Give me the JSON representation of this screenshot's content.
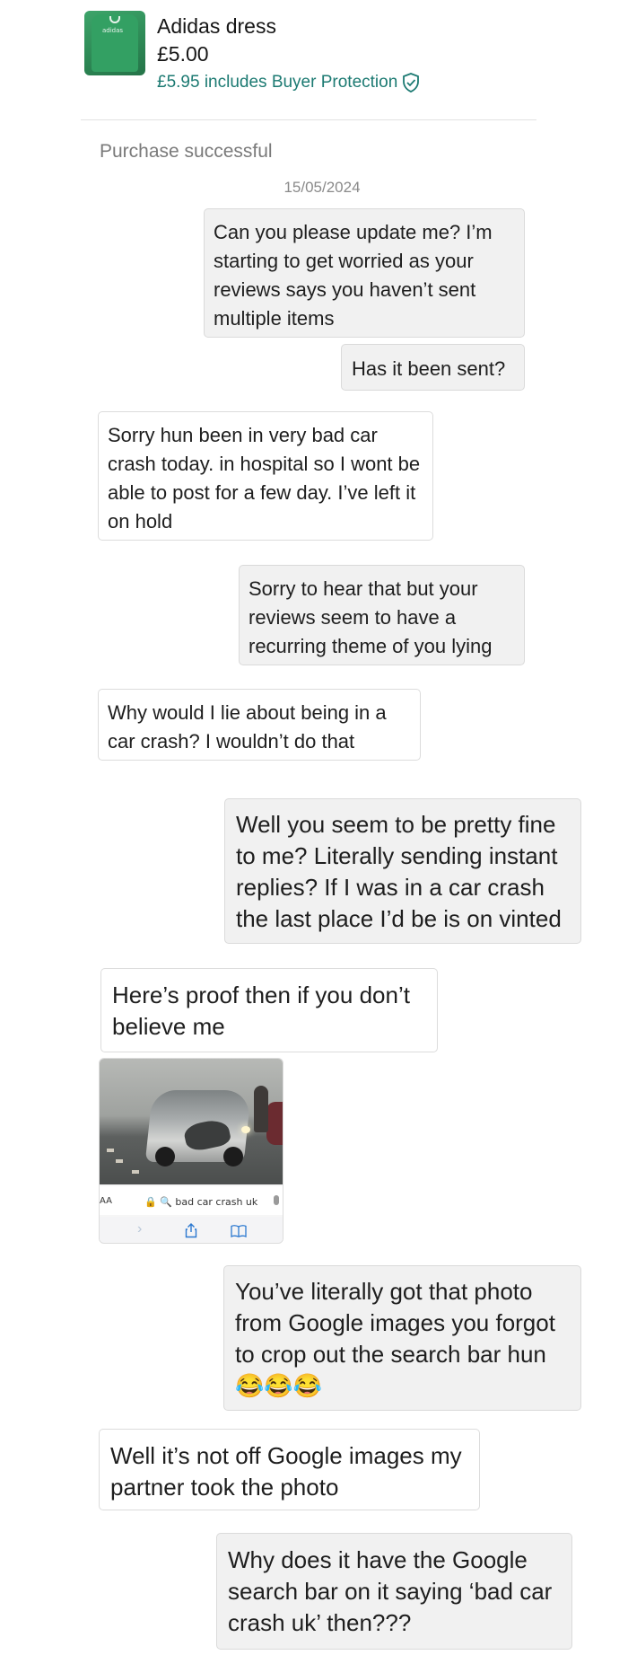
{
  "item": {
    "title": "Adidas dress",
    "price": "£5.00",
    "protection": "£5.95 includes Buyer Protection",
    "thumb_brand": "adidas"
  },
  "status": "Purchase successful",
  "date": "15/05/2024",
  "messages": [
    {
      "from": "me",
      "text": "Can you please update me? I’m starting to get worried as your reviews says you haven’t sent multiple items"
    },
    {
      "from": "me",
      "text": "Has it been sent?"
    },
    {
      "from": "seller",
      "text": "Sorry hun been in very bad car crash today. in hospital so I wont be able to post for a few day. I’ve left it on hold"
    },
    {
      "from": "me",
      "text": "Sorry to hear that but your reviews seem to have a recurring theme of you lying"
    },
    {
      "from": "seller",
      "text": "Why would I lie about being in a car crash? I wouldn’t do that"
    },
    {
      "from": "me",
      "text": "Well you seem to be pretty fine to me? Literally sending instant replies? If I was in a car crash the last place I’d be is on vinted"
    },
    {
      "from": "seller",
      "text": "Here’s proof then if you don’t believe me"
    },
    {
      "from": "me",
      "text": "You’ve literally got that photo from Google images you forgot to crop out the search bar hun 😂😂😂"
    },
    {
      "from": "seller",
      "text": "Well it’s not off Google images my partner took the photo"
    },
    {
      "from": "me",
      "text": "Why does it have the Google search bar on it saying ‘bad car crash uk’ then???"
    }
  ],
  "attachment": {
    "aa_label": "AA",
    "url_text": "🔒 🔍 bad car crash uk"
  },
  "colors": {
    "accent": "#1c7a72",
    "outgoing_bubble": "#f1f1f1",
    "incoming_bubble": "#ffffff"
  }
}
